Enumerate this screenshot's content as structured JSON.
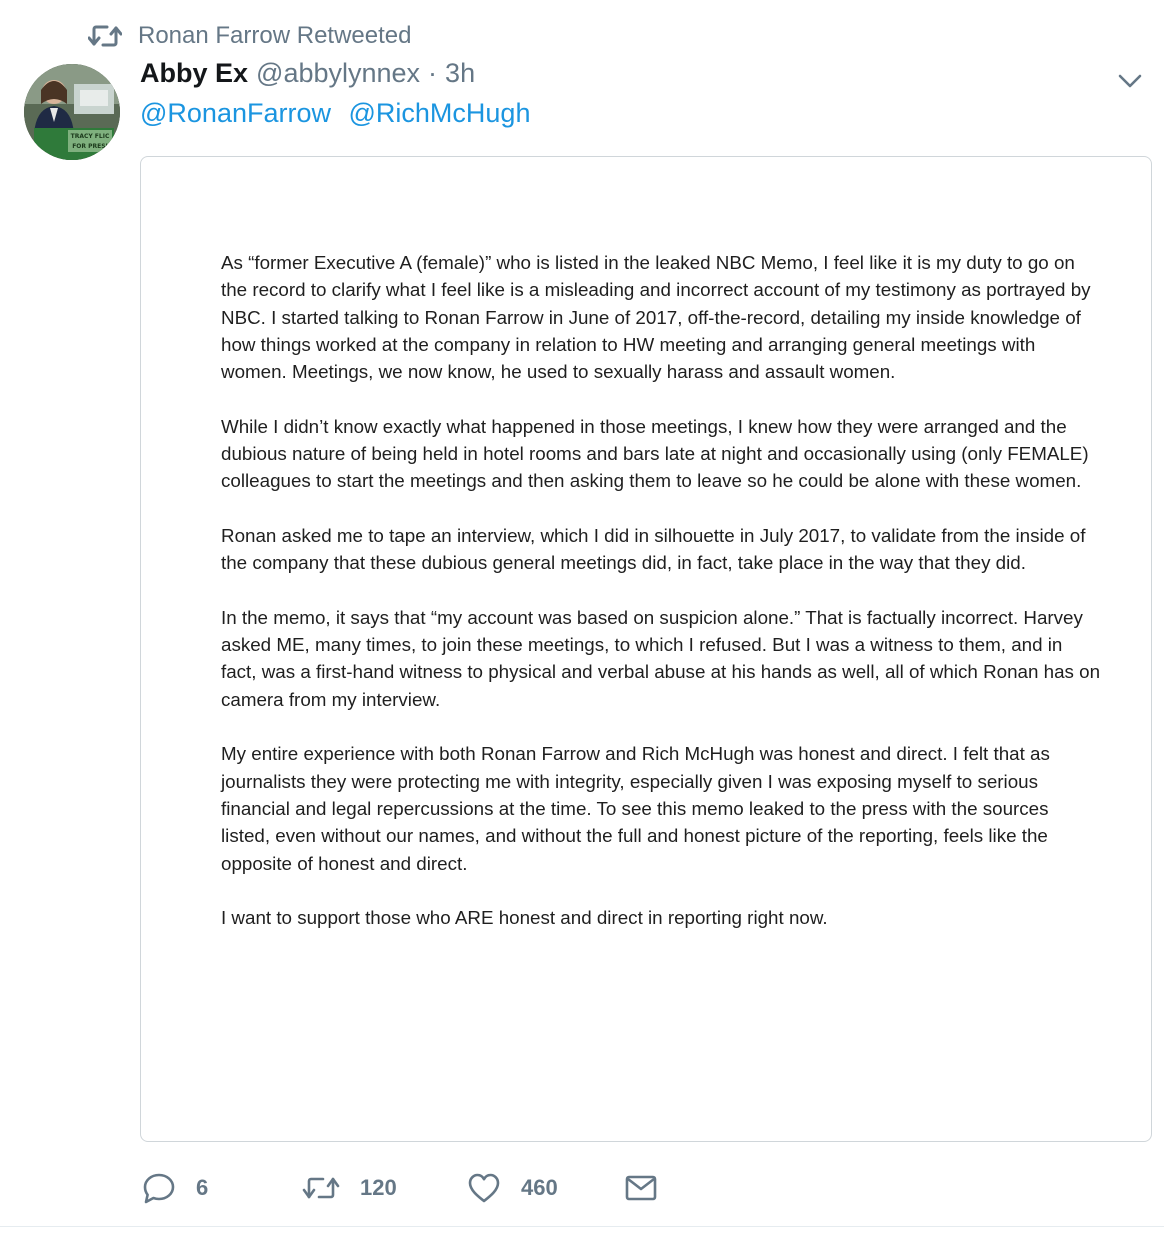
{
  "retweet_context": {
    "icon": "retweet-icon",
    "text": "Ronan Farrow Retweeted"
  },
  "author": {
    "display_name": "Abby Ex",
    "screen_name": "@abbylynnex",
    "separator": "·",
    "timestamp": "3h",
    "avatar_text": "TRACY FLICK FOR PRESIDENT"
  },
  "reply_to": [
    "@RonanFarrow",
    "@RichMcHugh"
  ],
  "document": {
    "paragraphs": [
      "As “former Executive A (female)” who is listed in the leaked NBC Memo, I feel like it is my duty to go on the record to clarify what I feel like is a misleading and incorrect account of my testimony as portrayed by NBC. I started talking to Ronan Farrow in June of 2017, off-the-record, detailing my inside knowledge of how things worked at the company in relation to HW meeting and arranging general meetings with women. Meetings, we now know, he used to sexually harass and assault women.",
      "While I didn’t know exactly what happened in those meetings, I knew how they were arranged and the dubious nature of being held in hotel rooms and bars late at night and occasionally using (only FEMALE) colleagues to start the meetings and then asking them to leave so he could be alone with these women.",
      "Ronan asked me to tape an interview, which I did in silhouette in July 2017, to validate from the inside of the company that these dubious general meetings did, in fact, take place in the way that they did.",
      "In the memo, it says that “my account was based on suspicion alone.” That is factually incorrect. Harvey asked ME, many times, to join these meetings, to which I refused. But I was a witness to them, and in fact, was a first-hand witness to physical and verbal abuse at his hands as well, all of which Ronan has on camera from my interview.",
      "My entire experience with both Ronan Farrow and Rich McHugh was honest and direct. I felt that as journalists they were protecting me with integrity, especially given I was exposing myself to serious financial and legal repercussions at the time. To see this memo leaked to the press with the sources listed, even without our names, and without the full and honest picture of the reporting, feels like the opposite of honest and direct.",
      "I want to support those who ARE honest and direct in reporting right now."
    ]
  },
  "actions": {
    "reply": {
      "icon": "reply-icon",
      "count": "6"
    },
    "retweet": {
      "icon": "retweet-icon",
      "count": "120"
    },
    "like": {
      "icon": "heart-icon",
      "count": "460"
    },
    "message": {
      "icon": "envelope-icon"
    }
  },
  "colors": {
    "secondary_text": "#657786",
    "link": "#1b95e0",
    "primary_text": "#14171a",
    "border": "#d0d6da"
  }
}
